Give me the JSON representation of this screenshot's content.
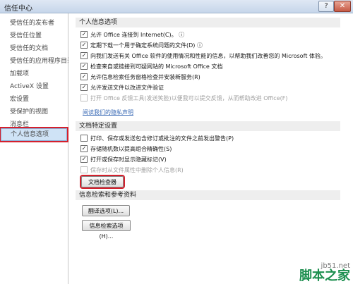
{
  "window": {
    "title": "信任中心",
    "help_glyph": "?",
    "close_glyph": "✕"
  },
  "sidebar": {
    "items": [
      {
        "label": "受信任的发布者"
      },
      {
        "label": "受信任位置"
      },
      {
        "label": "受信任的文档"
      },
      {
        "label": "受信任的应用程序目录"
      },
      {
        "label": "加载项"
      },
      {
        "label": "ActiveX 设置"
      },
      {
        "label": "宏设置"
      },
      {
        "label": "受保护的视图"
      },
      {
        "label": "消息栏"
      },
      {
        "label": "文件阻止设置"
      },
      {
        "label": "个人信息选项"
      }
    ],
    "active_index": 10
  },
  "privacy": {
    "header": "个人信息选项",
    "options": [
      {
        "label": "允许 Office 连接到 Internet(C)。",
        "checked": true,
        "disabled": false,
        "has_info": true
      },
      {
        "label": "定期下载一个用于确定系统问题的文件(D)",
        "checked": true,
        "disabled": false,
        "has_info": true
      },
      {
        "label": "向我们发送有关 Office 软件的使用情况和性能的信息，以帮助我们改善您的 Microsoft 体验。",
        "checked": true,
        "disabled": false,
        "has_info": false
      },
      {
        "label": "检查来自或链接到可疑网站的 Microsoft Office 文档",
        "checked": true,
        "disabled": false,
        "has_info": false
      },
      {
        "label": "允许信息检索任务窗格检查并安装新服务(R)",
        "checked": true,
        "disabled": false,
        "has_info": false
      },
      {
        "label": "允许发送文件以改进文件验证",
        "checked": true,
        "disabled": false,
        "has_info": false
      },
      {
        "label": "打开 Office 反馈工具(发送笑脸)以便我可以提交反馈，从而帮助改进 Office(F)",
        "checked": false,
        "disabled": true,
        "has_info": false
      }
    ],
    "statement_link": "阅读我们的隐私声明"
  },
  "document": {
    "header": "文档特定设置",
    "options": [
      {
        "label": "打印、保存或发送包含修订或批注的文件之前发出警告(P)",
        "checked": false,
        "disabled": false
      },
      {
        "label": "存储随机数以提高组合精确性(S)",
        "checked": true,
        "disabled": false
      },
      {
        "label": "打开或保存时显示隐藏标记(V)",
        "checked": true,
        "disabled": false
      },
      {
        "label": "保存时从文件属性中删除个人信息(R)",
        "checked": false,
        "disabled": true
      }
    ],
    "inspector_button": "文档检查器(I)..."
  },
  "research": {
    "header": "信息检索和参考资料",
    "translate_button": "翻译选项(L)...",
    "research_button": "信息检索选项(H)..."
  },
  "watermark": {
    "url": "jb51.net",
    "brand": "脚本之家"
  },
  "colors": {
    "highlight_red": "#d4202d",
    "section_bg": "#eeeeee",
    "active_bg": "#cfe3f6",
    "link": "#3b6bb6"
  }
}
